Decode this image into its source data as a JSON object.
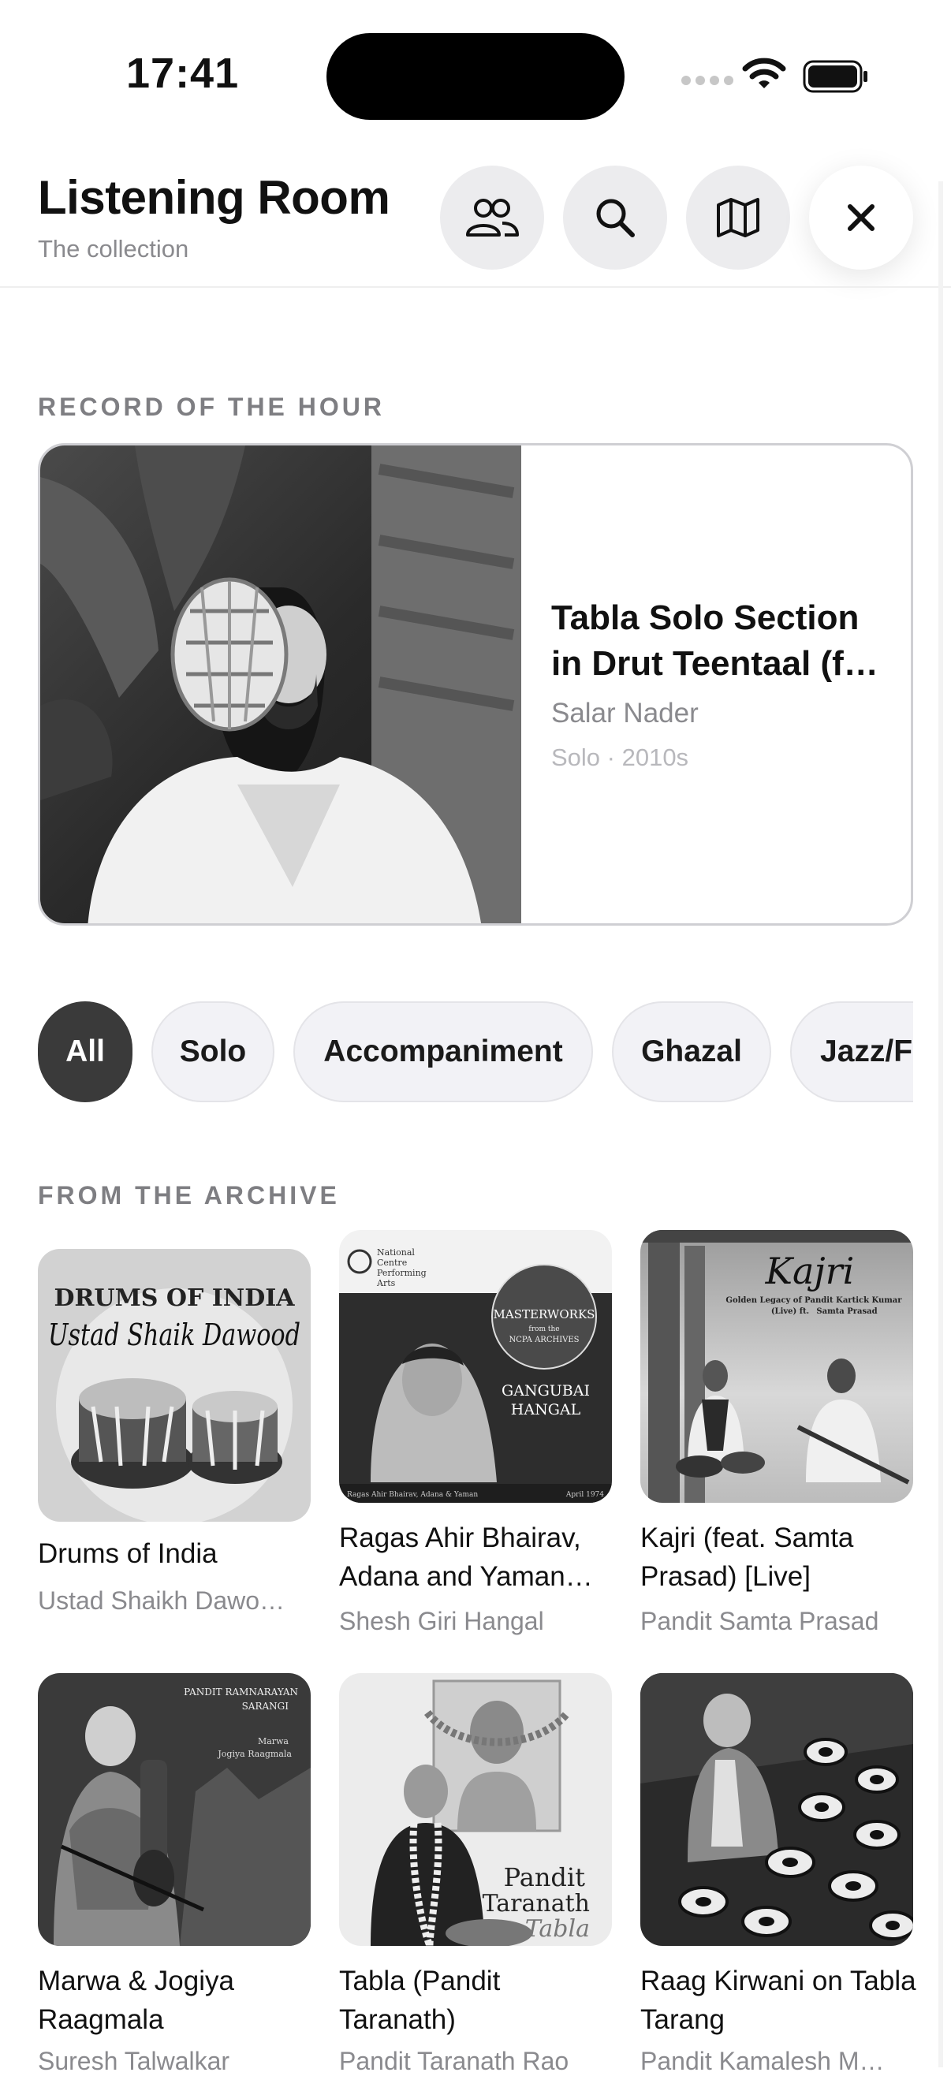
{
  "status": {
    "time": "17:41"
  },
  "header": {
    "title": "Listening Room",
    "subtitle": "The collection",
    "buttons": [
      "people-icon",
      "search-icon",
      "map-icon",
      "close-icon"
    ]
  },
  "featured": {
    "section": "RECORD OF THE HOUR",
    "title": "Tabla Solo Section in Drut Teentaal (f…",
    "artist": "Salar Nader",
    "meta": "Solo · 2010s"
  },
  "filters": [
    "All",
    "Solo",
    "Accompaniment",
    "Ghazal",
    "Jazz/F"
  ],
  "filters_selected": "All",
  "archive": {
    "section": "FROM THE ARCHIVE",
    "items": [
      {
        "title": "Drums of India",
        "artist": "Ustad Shaikh Dawo…",
        "cover_text": [
          "DRUMS OF INDIA",
          "Ustad Shaik Dawood"
        ]
      },
      {
        "title": "Ragas Ahir Bhairav, Adana and Yaman…",
        "artist": "Shesh Giri Hangal",
        "cover_text": [
          "National",
          "Centre",
          "Performing",
          "Arts",
          "MASTERWORKS",
          "from the",
          "NCPA ARCHIVES",
          "GANGUBAI",
          "HANGAL",
          "Ragas Ahir Bhairav, Adana & Yaman",
          "April 1974"
        ]
      },
      {
        "title": "Kajri (feat. Samta Prasad) [Live]",
        "artist": "Pandit Samta Prasad",
        "cover_text": [
          "Kajri",
          "Golden Legacy of Pandit Kartick Kumar",
          "(Live) ft.",
          "Samta Prasad"
        ]
      },
      {
        "title": "Marwa & Jogiya Raagmala",
        "artist": "Suresh Talwalkar",
        "cover_text": [
          "PANDIT RAMNARAYAN",
          "SARANGI",
          "Marwa",
          "Jogiya Raagmala"
        ]
      },
      {
        "title": "Tabla (Pandit Taranath)",
        "artist": "Pandit Taranath Rao",
        "cover_text": [
          "Pandit",
          "Taranath",
          "Tabla"
        ]
      },
      {
        "title": "Raag Kirwani on Tabla Tarang",
        "artist": "Pandit Kamalesh M…",
        "cover_text": []
      }
    ]
  }
}
